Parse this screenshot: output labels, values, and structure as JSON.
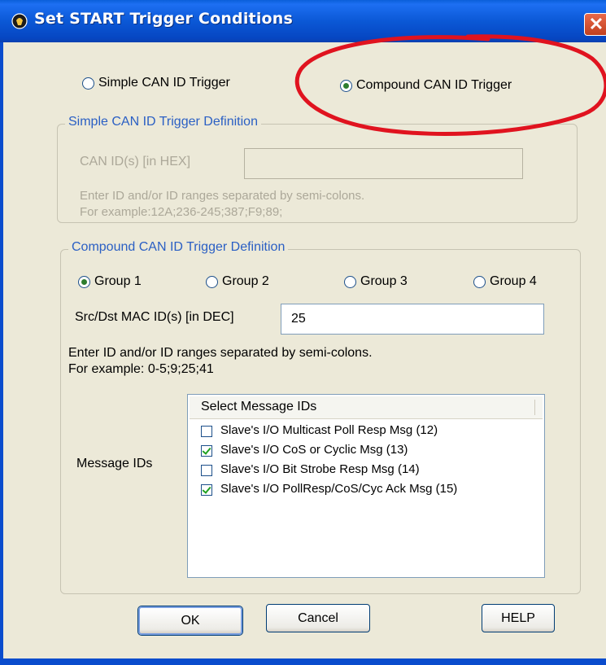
{
  "window": {
    "title": "Set START Trigger Conditions",
    "close_glyph": "✕"
  },
  "trigger_type": {
    "simple_label": "Simple CAN ID Trigger",
    "compound_label": "Compound CAN ID Trigger",
    "selected": "compound"
  },
  "simple_group": {
    "legend": "Simple CAN ID Trigger Definition",
    "field_label": "CAN ID(s) [in HEX]",
    "field_value": "",
    "help_line1": "Enter ID and/or ID ranges separated by semi-colons.",
    "help_line2": "For example:12A;236-245;387;F9;89;"
  },
  "compound_group": {
    "legend": "Compound CAN ID Trigger Definition",
    "groups": [
      {
        "label": "Group 1",
        "checked": true
      },
      {
        "label": "Group 2",
        "checked": false
      },
      {
        "label": "Group 3",
        "checked": false
      },
      {
        "label": "Group 4",
        "checked": false
      }
    ],
    "mac_label": "Src/Dst MAC ID(s) [in DEC]",
    "mac_value": "25",
    "help_line1": "Enter ID and/or ID ranges separated by semi-colons.",
    "help_line2": "For example: 0-5;9;25;41",
    "message_ids_label": "Message IDs",
    "list_header": "Select Message IDs",
    "messages": [
      {
        "label": "Slave's I/O Multicast Poll Resp Msg (12)",
        "checked": false
      },
      {
        "label": "Slave's I/O CoS or Cyclic Msg (13)",
        "checked": true
      },
      {
        "label": "Slave's I/O Bit Strobe Resp Msg (14)",
        "checked": false
      },
      {
        "label": "Slave's I/O PollResp/CoS/Cyc Ack Msg (15)",
        "checked": true
      }
    ]
  },
  "buttons": {
    "ok": "OK",
    "cancel": "Cancel",
    "help": "HELP"
  },
  "colors": {
    "titlebar": "#0a58d6",
    "legend_text": "#2a5fc4",
    "highlight_circle": "#e0131f",
    "dialog_bg": "#ece9d8"
  }
}
